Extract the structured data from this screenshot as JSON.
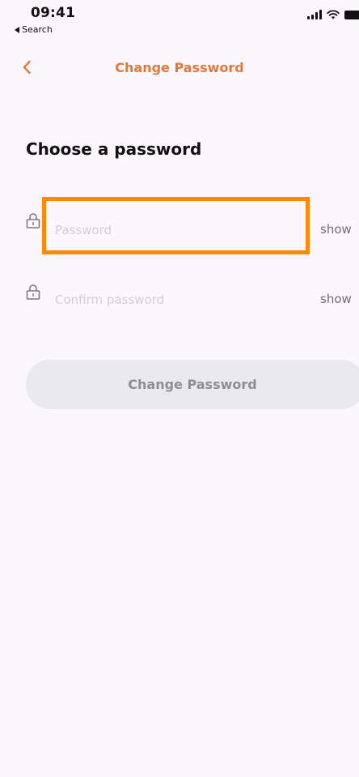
{
  "status_bar": {
    "time": "09:41",
    "back_label": "Search"
  },
  "nav": {
    "title": "Change Password"
  },
  "form": {
    "heading": "Choose a password",
    "password_placeholder": "Password",
    "confirm_placeholder": "Confirm password",
    "show_label": "show",
    "submit_label": "Change Password"
  },
  "colors": {
    "accent": "#e07a3a",
    "focus_outline": "#ff8a00",
    "background": "#fbf7fc",
    "button_disabled_bg": "#eaeaed"
  }
}
